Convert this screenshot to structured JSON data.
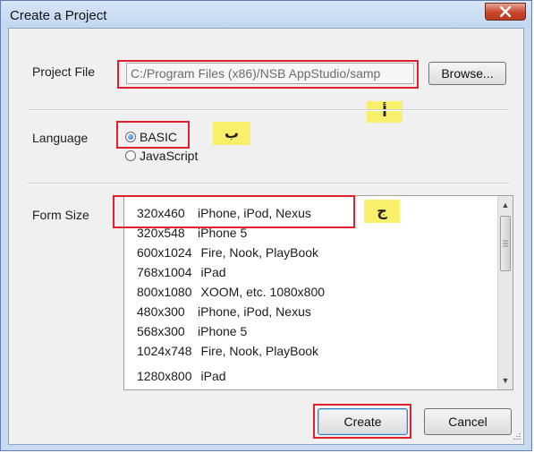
{
  "dialog": {
    "title": "Create a Project",
    "close_glyph": "X"
  },
  "project_file": {
    "label": "Project File",
    "value": "C:/Program Files (x86)/NSB AppStudio/samp",
    "browse_label": "Browse..."
  },
  "language": {
    "label": "Language",
    "options": [
      {
        "label": "BASIC",
        "selected": true
      },
      {
        "label": "JavaScript",
        "selected": false
      }
    ]
  },
  "form_size": {
    "label": "Form Size",
    "items": [
      {
        "res": "320x460",
        "devices": "iPhone, iPod, Nexus"
      },
      {
        "res": "320x548",
        "devices": "iPhone 5"
      },
      {
        "res": "600x1024",
        "devices": "Fire, Nook, PlayBook"
      },
      {
        "res": "768x1004",
        "devices": "iPad"
      },
      {
        "res": "800x1080",
        "devices": "XOOM, etc. 1080x800"
      },
      {
        "res": "480x300",
        "devices": "iPhone, iPod, Nexus"
      },
      {
        "res": "568x300",
        "devices": "iPhone 5"
      },
      {
        "res": "1024x748",
        "devices": "Fire, Nook, PlayBook"
      }
    ],
    "selected_index": 0
  },
  "annotations": {
    "a": "أ",
    "b": "ب",
    "c": "ج"
  },
  "buttons": {
    "create": "Create",
    "cancel": "Cancel"
  },
  "colors": {
    "highlight_box": "#e0202a",
    "tag_bg": "#f8ef6a",
    "title_bg": "#c9daf0"
  },
  "icons": {
    "close": "close-icon",
    "scroll_up": "scroll-up-arrow-icon",
    "scroll_down": "scroll-down-arrow-icon",
    "resize_grip": "resize-grip-icon"
  }
}
